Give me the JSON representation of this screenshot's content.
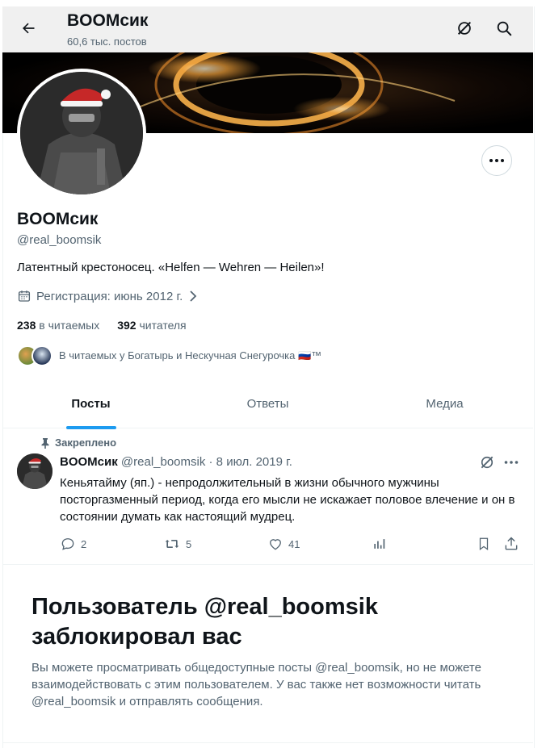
{
  "header": {
    "title": "BOOMсик",
    "posts_count": "60,6 тыс. постов"
  },
  "profile": {
    "name": "BOOMсик",
    "handle": "@real_boomsik",
    "bio": "Латентный крестоносец. «Helfen — Wehren — Heilen»!",
    "joined": "Регистрация: июнь 2012 г.",
    "following_count": "238",
    "following_label": "в читаемых",
    "followers_count": "392",
    "followers_label": "читателя",
    "followed_by": "В читаемых у Богатырь и Нескучная Снегурочка 🇷🇺™"
  },
  "tabs": [
    {
      "label": "Посты",
      "active": true
    },
    {
      "label": "Ответы",
      "active": false
    },
    {
      "label": "Медиа",
      "active": false
    }
  ],
  "pinned_post": {
    "pinned_label": "Закреплено",
    "author": "BOOMсик",
    "handle": "@real_boomsik",
    "date": "· 8 июл. 2019 г.",
    "text": "Кеньятайму (яп.) - непродолжительный в жизни обычного мужчины посторгазменный период, когда его мысли не искажает половое влечение и он в состоянии думать как настоящий мудрец.",
    "replies": "2",
    "reposts": "5",
    "likes": "41"
  },
  "blocked": {
    "title": "Пользователь @real_boomsik заблокировал вас",
    "text": "Вы можете просматривать общедоступные посты @real_boomsik, но не можете взаимодействовать с этим пользователем. У вас также нет возможности читать @real_boomsik и отправлять сообщения."
  },
  "colors": {
    "accent": "#1d9bf0",
    "text": "#0f1419",
    "secondary": "#536471",
    "border": "#eff3f4"
  }
}
